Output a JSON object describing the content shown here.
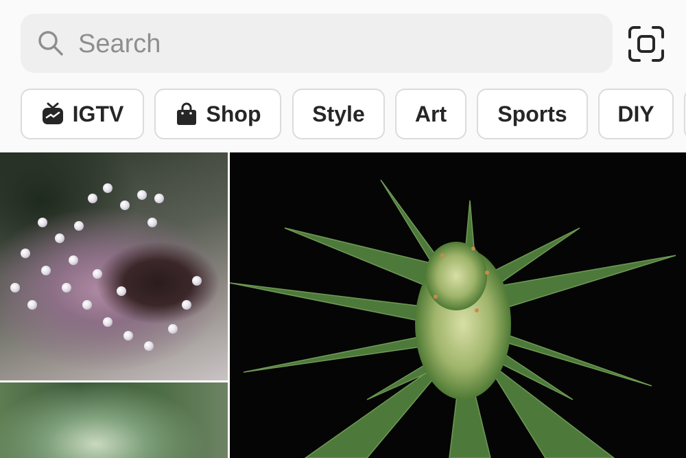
{
  "search": {
    "placeholder": "Search",
    "value": ""
  },
  "icons": {
    "search": "search-icon",
    "scan": "scan-icon",
    "igtv": "igtv-icon",
    "shop": "shopping-bag-icon"
  },
  "categories": [
    {
      "label": "IGTV",
      "icon": "igtv-icon"
    },
    {
      "label": "Shop",
      "icon": "shopping-bag-icon"
    },
    {
      "label": "Style"
    },
    {
      "label": "Art"
    },
    {
      "label": "Sports"
    },
    {
      "label": "DIY"
    }
  ],
  "colors": {
    "background": "#fafafa",
    "search_bg": "#efefef",
    "chip_border": "#dbdbdb",
    "text": "#262626",
    "placeholder": "#8e8e8e"
  }
}
